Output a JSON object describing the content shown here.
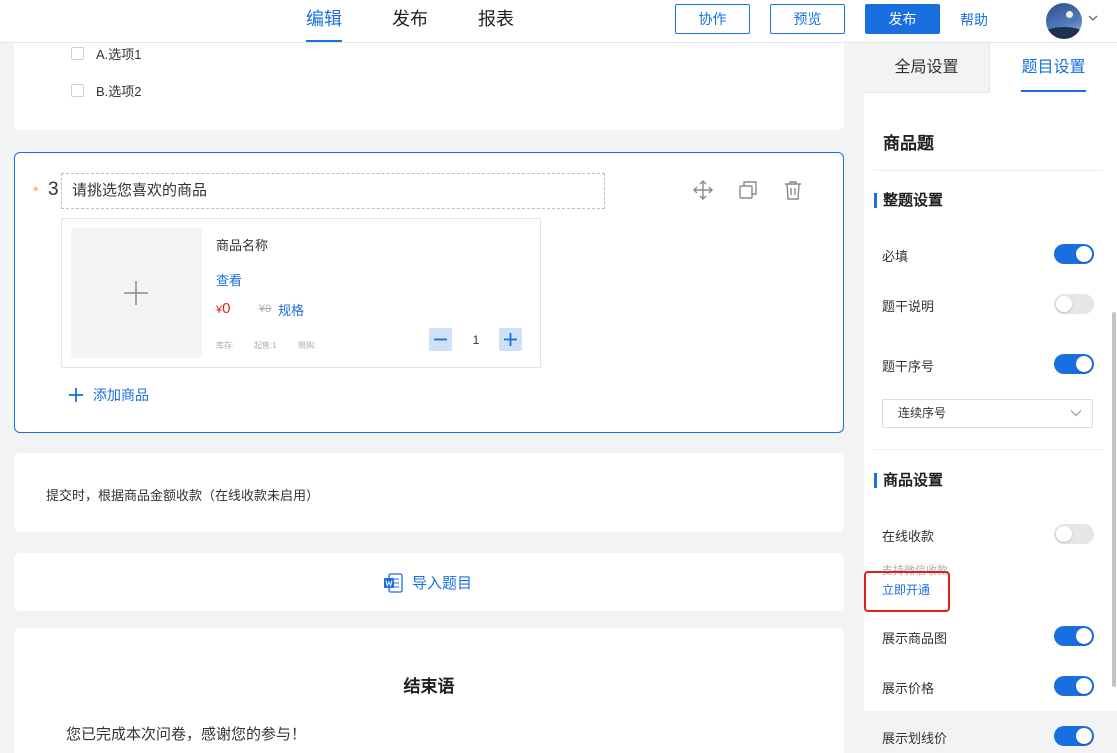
{
  "topbar": {
    "tabs": [
      {
        "label": "编辑",
        "active": true
      },
      {
        "label": "发布",
        "active": false
      },
      {
        "label": "报表",
        "active": false
      }
    ],
    "collaborate": "协作",
    "preview": "预览",
    "publish": "发布",
    "help": "帮助"
  },
  "prev_question": {
    "options": [
      "A.选项1",
      "B.选项2"
    ]
  },
  "question": {
    "number": "3",
    "required_mark": "*",
    "title": "请挑选您喜欢的商品",
    "product": {
      "name": "商品名称",
      "view": "查看",
      "currency": "¥",
      "price": "0",
      "original_price": "¥0",
      "spec": "规格",
      "stock_label": "库存:",
      "min_label": "起售:1",
      "limit_label": "限购:",
      "quantity": "1"
    },
    "add_product": "添加商品"
  },
  "payment_note": "提交时，根据商品金额收款（在线收款未启用）",
  "import_label": "导入题目",
  "ending": {
    "title": "结束语",
    "text": "您已完成本次问卷，感谢您的参与！"
  },
  "panel": {
    "tab_global": "全局设置",
    "tab_question": "题目设置",
    "heading": "商品题",
    "section1": "整题设置",
    "required": {
      "label": "必填",
      "on": true
    },
    "description": {
      "label": "题干说明",
      "on": false
    },
    "numbering": {
      "label": "题干序号",
      "on": true
    },
    "numbering_select": "连续序号",
    "section2": "商品设置",
    "online_payment": {
      "label": "在线收款",
      "on": false
    },
    "wechat_hint": "支持微信收款",
    "activate": "立即开通",
    "show_image": {
      "label": "展示商品图",
      "on": true
    },
    "show_price": {
      "label": "展示价格",
      "on": true
    },
    "show_strike_price": {
      "label": "展示划线价",
      "on": true
    }
  },
  "colors": {
    "accent": "#1a6fe0",
    "price": "#e02020",
    "star": "#f5a623",
    "highlight_box": "#e02020"
  }
}
